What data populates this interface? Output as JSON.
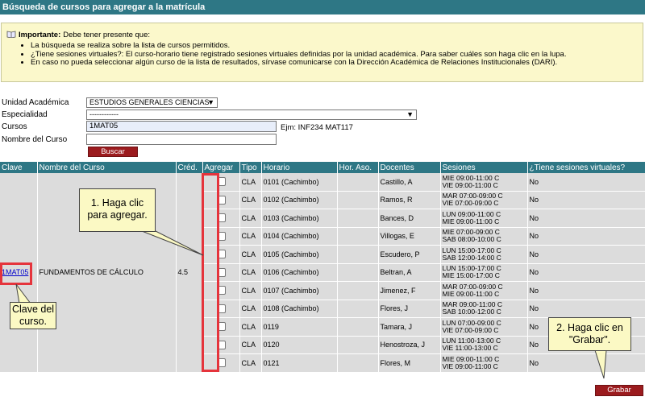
{
  "title": "Búsqueda de cursos para agregar a la matrícula",
  "notice": {
    "icon": "info-book-icon",
    "heading": "Importante:",
    "intro": " Debe tener presente que:",
    "items": [
      "La búsqueda se realiza sobre la lista de cursos permitidos.",
      "¿Tiene sesiones virtuales?: El curso-horario tiene registrado sesiones virtuales definidas por la unidad académica. Para saber cuáles son haga clic en la lupa.",
      "En caso no pueda seleccionar algún curso de la lista de resultados, sírvase comunicarse con la Dirección Académica de Relaciones Institucionales (DARI)."
    ]
  },
  "form": {
    "unidad_label": "Unidad Académica",
    "unidad_value": "ESTUDIOS GENERALES CIENCIAS",
    "especialidad_label": "Especialidad",
    "especialidad_value": "------------",
    "cursos_label": "Cursos",
    "cursos_value": "1MAT05",
    "cursos_hint": "Ejm: INF234 MAT117",
    "nombre_label": "Nombre del Curso",
    "nombre_value": "",
    "buscar_label": "Buscar"
  },
  "table": {
    "headers": [
      "Clave",
      "Nombre del Curso",
      "Créd.",
      "Agregar",
      "Tipo",
      "Horario",
      "Hor. Aso.",
      "Docentes",
      "Sesiones",
      "¿Tiene sesiones virtuales?"
    ],
    "course_key": "1MAT05",
    "course_name": "FUNDAMENTOS DE CÁLCULO",
    "credits": "4.5",
    "rows": [
      {
        "tipo": "CLA",
        "horario": "0101 (Cachimbo)",
        "docente": "Castillo, A",
        "ses1": "MIE 09:00-11:00 C",
        "ses2": "VIE 09:00-11:00 C",
        "virtual": "No"
      },
      {
        "tipo": "CLA",
        "horario": "0102 (Cachimbo)",
        "docente": "Ramos, R",
        "ses1": "MAR 07:00-09:00 C",
        "ses2": "VIE 07:00-09:00 C",
        "virtual": "No"
      },
      {
        "tipo": "CLA",
        "horario": "0103 (Cachimbo)",
        "docente": "Bances, D",
        "ses1": "LUN 09:00-11:00 C",
        "ses2": "MIE 09:00-11:00 C",
        "virtual": "No"
      },
      {
        "tipo": "CLA",
        "horario": "0104 (Cachimbo)",
        "docente": "Villogas, E",
        "ses1": "MIE 07:00-09:00 C",
        "ses2": "SAB 08:00-10:00 C",
        "virtual": "No"
      },
      {
        "tipo": "CLA",
        "horario": "0105 (Cachimbo)",
        "docente": "Escudero, P",
        "ses1": "LUN 15:00-17:00 C",
        "ses2": "SAB 12:00-14:00 C",
        "virtual": "No"
      },
      {
        "tipo": "CLA",
        "horario": "0106 (Cachimbo)",
        "docente": "Beltran, A",
        "ses1": "LUN 15:00-17:00 C",
        "ses2": "MIE 15:00-17:00 C",
        "virtual": "No"
      },
      {
        "tipo": "CLA",
        "horario": "0107 (Cachimbo)",
        "docente": "Jimenez, F",
        "ses1": "MAR 07:00-09:00 C",
        "ses2": "MIE 09:00-11:00 C",
        "virtual": "No"
      },
      {
        "tipo": "CLA",
        "horario": "0108 (Cachimbo)",
        "docente": "Flores, J",
        "ses1": "MAR 09:00-11:00 C",
        "ses2": "SAB 10:00-12:00 C",
        "virtual": "No"
      },
      {
        "tipo": "CLA",
        "horario": "0119",
        "docente": "Tamara, J",
        "ses1": "LUN 07:00-09:00 C",
        "ses2": "VIE 07:00-09:00 C",
        "virtual": "No"
      },
      {
        "tipo": "CLA",
        "horario": "0120",
        "docente": "Henostroza, J",
        "ses1": "LUN 11:00-13:00 C",
        "ses2": "VIE 11:00-13:00 C",
        "virtual": "No"
      },
      {
        "tipo": "CLA",
        "horario": "0121",
        "docente": "Flores, M",
        "ses1": "MIE 09:00-11:00 C",
        "ses2": "VIE 09:00-11:00 C",
        "virtual": "No"
      }
    ]
  },
  "grabar_label": "Grabar",
  "callouts": {
    "agregar": "1. Haga clic para agregar.",
    "clave": "Clave del curso.",
    "grabar": "2. Haga clic en \"Grabar\"."
  },
  "colors": {
    "header_bg": "#2e7785",
    "notice_bg": "#fbf8cb",
    "button_red": "#9b1b1e",
    "highlight_red": "#e5343c",
    "callout_bg": "#fbf9c4"
  }
}
